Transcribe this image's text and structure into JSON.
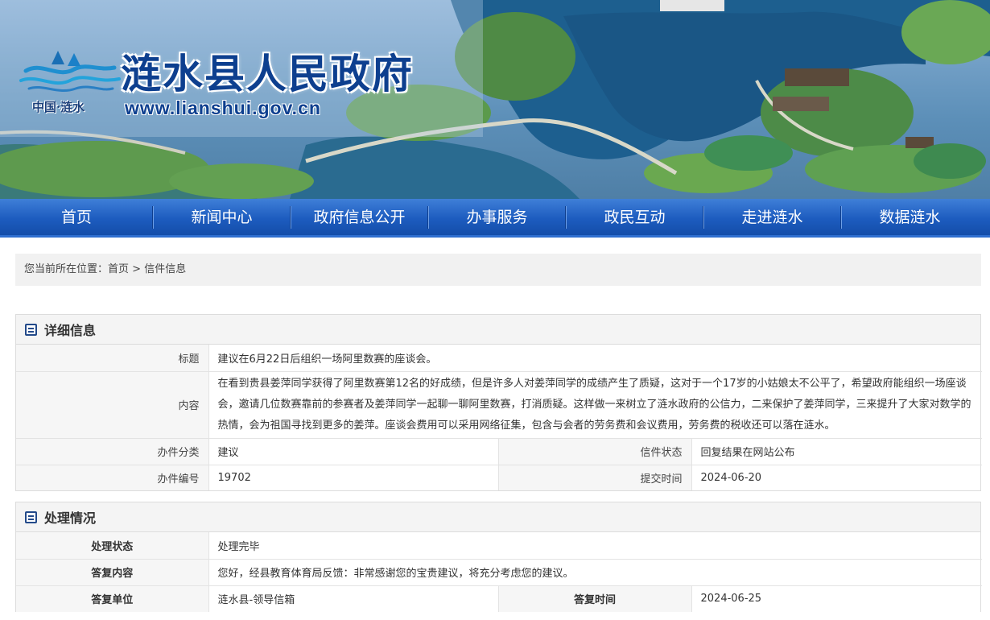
{
  "header": {
    "site_title": "涟水县人民政府",
    "site_url": "www.lianshui.gov.cn",
    "logo_sub": "中国·涟水"
  },
  "nav": {
    "items": [
      "首页",
      "新闻中心",
      "政府信息公开",
      "办事服务",
      "政民互动",
      "走进涟水",
      "数据涟水"
    ]
  },
  "breadcrumb": {
    "prefix": "您当前所在位置：",
    "home": "首页",
    "sep": " > ",
    "current": "信件信息"
  },
  "detail": {
    "heading": "详细信息",
    "title_label": "标题",
    "title_value": "建议在6月22日后组织一场阿里数赛的座谈会。",
    "content_label": "内容",
    "content_value": "在看到贵县姜萍同学获得了阿里数赛第12名的好成绩，但是许多人对姜萍同学的成绩产生了质疑，这对于一个17岁的小姑娘太不公平了，希望政府能组织一场座谈会，邀请几位数赛靠前的参赛者及姜萍同学一起聊一聊阿里数赛，打消质疑。这样做一来树立了涟水政府的公信力，二来保护了姜萍同学，三来提升了大家对数学的热情，会为祖国寻找到更多的姜萍。座谈会费用可以采用网络征集，包含与会者的劳务费和会议费用，劳务费的税收还可以落在涟水。",
    "category_label": "办件分类",
    "category_value": "建议",
    "status_label": "信件状态",
    "status_value": "回复结果在网站公布",
    "number_label": "办件编号",
    "number_value": "19702",
    "submit_label": "提交时间",
    "submit_value": "2024-06-20"
  },
  "handling": {
    "heading": "处理情况",
    "state_label": "处理状态",
    "state_value": "处理完毕",
    "reply_label": "答复内容",
    "reply_value": "您好，经县教育体育局反馈：非常感谢您的宝贵建议，将充分考虑您的建议。",
    "unit_label": "答复单位",
    "unit_value": "涟水县-领导信箱",
    "time_label": "答复时间",
    "time_value": "2024-06-25"
  },
  "colors": {
    "nav_blue": "#1d5cbf",
    "title_blue": "#0d3f8f",
    "panel_icon": "#234a8a"
  }
}
